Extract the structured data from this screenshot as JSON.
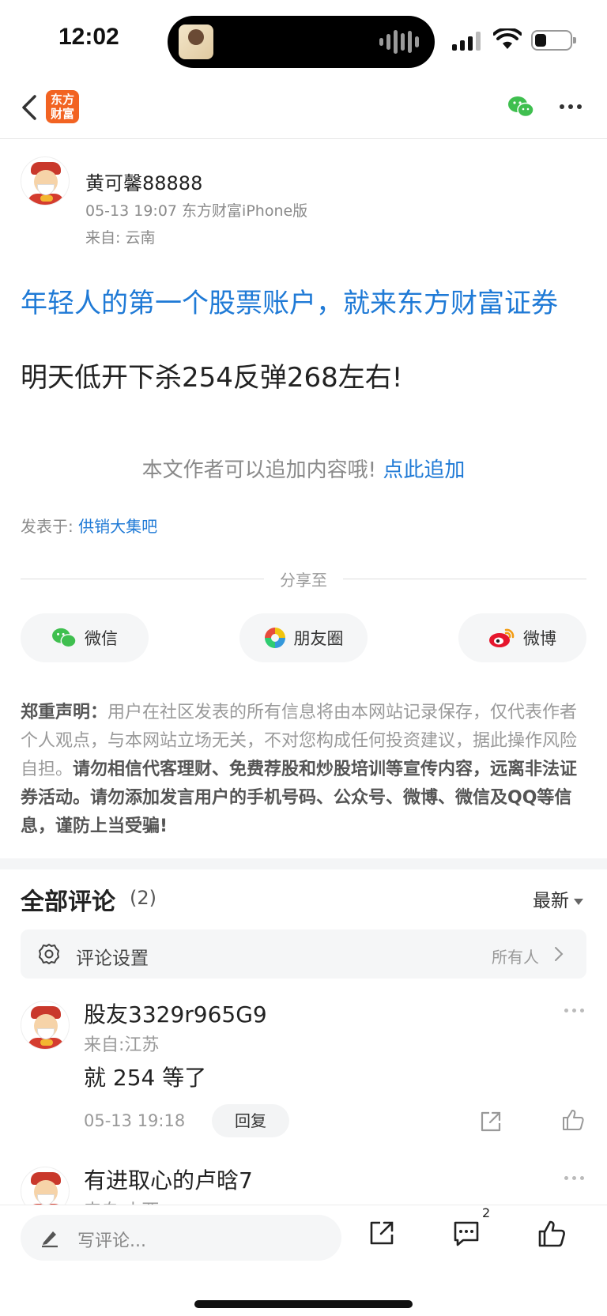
{
  "status_bar": {
    "time": "12:02"
  },
  "nav": {
    "logo_line1": "东方",
    "logo_line2": "财富"
  },
  "post": {
    "author": "黄可馨88888",
    "meta": "05-13 19:07 东方财富iPhone版",
    "location": "来自: 云南",
    "ad_text": "年轻人的第一个股票账户，就来东方财富证券",
    "body": "明天低开下杀254反弹268左右!",
    "append_prompt": "本文作者可以追加内容哦!",
    "append_link": "点此追加",
    "posted_in_label": "发表于:",
    "posted_in_bar": "供销大集吧"
  },
  "share": {
    "title": "分享至",
    "buttons": [
      {
        "label": "微信"
      },
      {
        "label": "朋友圈"
      },
      {
        "label": "微博"
      }
    ]
  },
  "disclaimer": {
    "title": "郑重声明：",
    "normal": "用户在社区发表的所有信息将由本网站记录保存，仅代表作者个人观点，与本网站立场无关，不对您构成任何投资建议，据此操作风险自担。",
    "bold": "请勿相信代客理财、免费荐股和炒股培训等宣传内容，远离非法证券活动。请勿添加发言用户的手机号码、公众号、微博、微信及QQ等信息，谨防上当受骗!"
  },
  "comments": {
    "title": "全部评论",
    "count": "(2)",
    "sort": "最新",
    "settings_label": "评论设置",
    "settings_value": "所有人",
    "items": [
      {
        "name": "股友3329r965G9",
        "location": "来自:江苏",
        "text": "就 254 等了",
        "time": "05-13 19:18",
        "reply": "回复"
      },
      {
        "name": "有进取心的卢晗7",
        "location": "来自:山西"
      }
    ]
  },
  "bottom_bar": {
    "placeholder": "写评论...",
    "comment_badge": "2"
  }
}
